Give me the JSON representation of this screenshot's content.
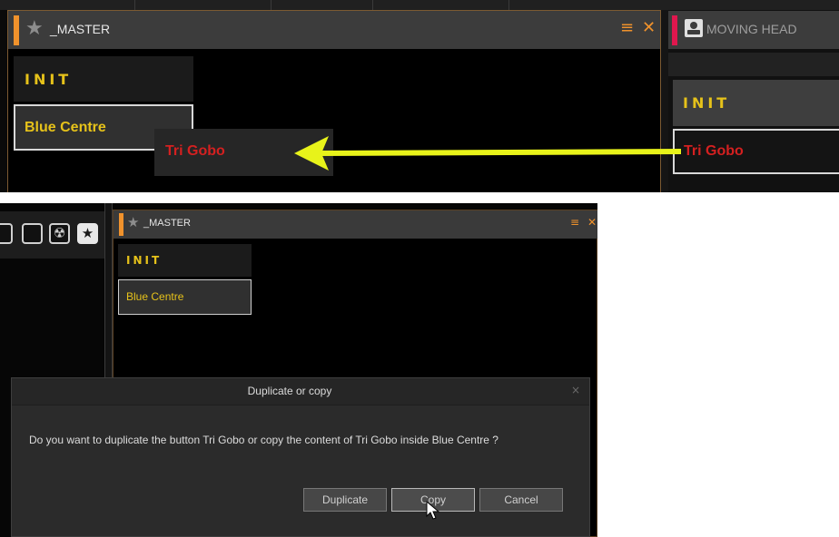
{
  "top_panel": {
    "master": {
      "title": "_MASTER",
      "accent_color": "#f0922c",
      "icons": [
        "star-icon",
        "menu-icon",
        "close-icon"
      ],
      "menu_glyph": "≡",
      "close_glyph": "✕",
      "buttons": [
        {
          "label": "INIT",
          "color": "#e6c21a"
        },
        {
          "label": "Blue Centre",
          "color": "#e6c21a",
          "selected": true
        }
      ]
    },
    "dragged_button": {
      "label": "Tri Gobo",
      "color": "#d42020"
    },
    "drag_arrow": {
      "direction": "left",
      "color": "#e8f31a"
    },
    "moving_head": {
      "title": "MOVING HEAD",
      "accent_color": "#e0174e",
      "icons": [
        "fixture-icon"
      ],
      "buttons": [
        {
          "label": "INIT",
          "color": "#e6c21a"
        },
        {
          "label": "Tri Gobo",
          "color": "#d42020",
          "selected": true
        }
      ]
    }
  },
  "bottom_panel": {
    "toolbar_icons": [
      "blank-square-icon",
      "blank-square-icon",
      "radiation-icon",
      "star-icon"
    ],
    "master": {
      "title": "_MASTER",
      "menu_glyph": "≡",
      "close_glyph": "✕",
      "buttons": [
        {
          "label": "INIT"
        },
        {
          "label": "Blue Centre",
          "selected": true
        }
      ]
    },
    "dialog": {
      "title": "Duplicate or copy",
      "close_glyph": "×",
      "message": "Do you want to duplicate the button Tri Gobo or copy the content of Tri Gobo inside Blue Centre ?",
      "buttons": {
        "duplicate": "Duplicate",
        "copy": "Copy",
        "cancel": "Cancel"
      },
      "hovered_button": "copy"
    }
  }
}
